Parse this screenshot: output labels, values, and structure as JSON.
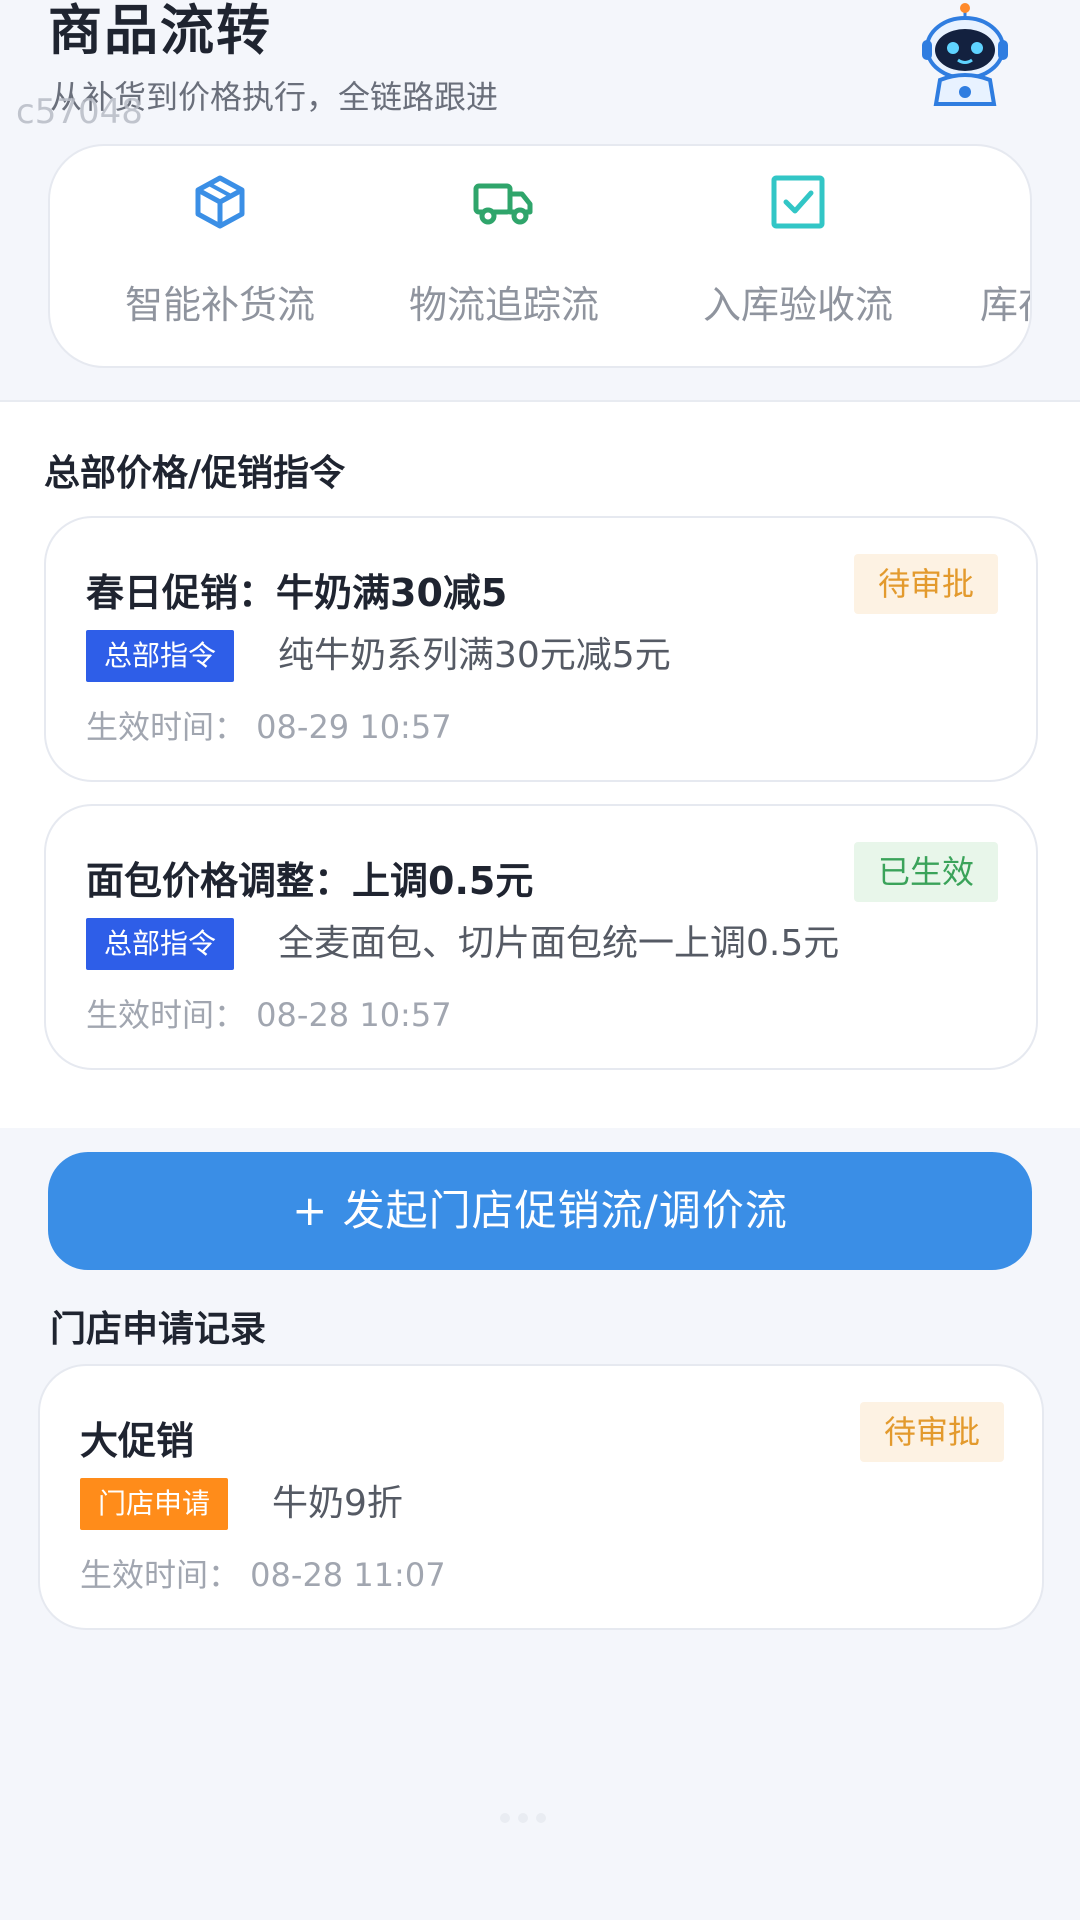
{
  "header": {
    "title": "商品流转",
    "subtitle": "从补货到价格执行，全链路跟进",
    "watermark": "c57048"
  },
  "flows": [
    {
      "label": "智能补货流",
      "icon": "cube-icon",
      "color": "#3b8fe6"
    },
    {
      "label": "物流追踪流",
      "icon": "truck-icon",
      "color": "#2fa56b"
    },
    {
      "label": "入库验收流",
      "icon": "checkbox-icon",
      "color": "#32c6c6"
    },
    {
      "label": "库存",
      "icon": "",
      "color": "#8f949e"
    }
  ],
  "hq_section": {
    "title": "总部价格/促销指令",
    "cards": [
      {
        "title": "春日促销：牛奶满30减5",
        "status": "待审批",
        "tag": "总部指令",
        "desc": "纯牛奶系列满30元减5元",
        "time": "生效时间：  08-29 10:57"
      },
      {
        "title": "面包价格调整：上调0.5元",
        "status": "已生效",
        "tag": "总部指令",
        "desc": "全麦面包、切片面包统一上调0.5元",
        "time": "生效时间：  08-28 10:57"
      }
    ]
  },
  "cta_label": "+ 发起门店促销流/调价流",
  "store_section": {
    "title": "门店申请记录",
    "cards": [
      {
        "title": "大促销",
        "status": "待审批",
        "tag": "门店申请",
        "desc": "牛奶9折",
        "time": "生效时间：  08-28 11:07"
      }
    ]
  },
  "colors": {
    "primary": "#3a8ee6",
    "hq_tag": "#2e5ee8",
    "store_tag": "#ff8c1a",
    "pending": "#e39a2d",
    "active": "#3aa35a"
  }
}
